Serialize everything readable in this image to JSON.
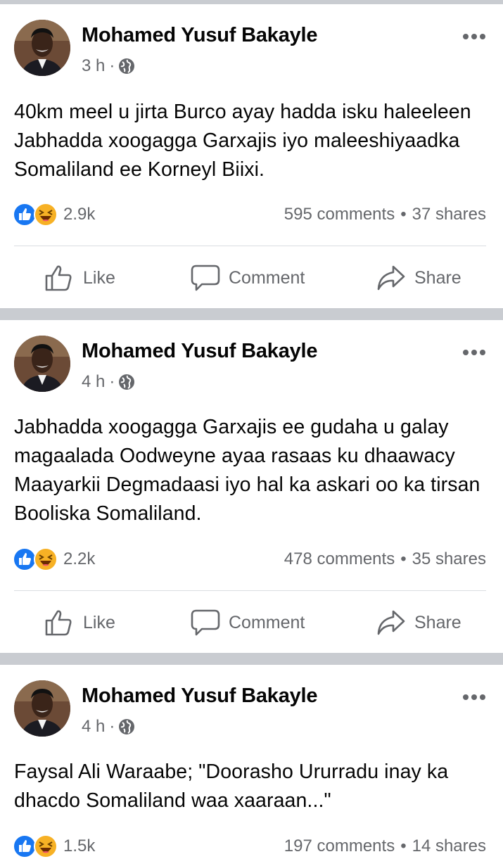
{
  "posts": [
    {
      "author": "Mohamed Yusuf Bakayle",
      "time": "3 h",
      "separator": "·",
      "text": "40km meel u jirta Burco ayay hadda isku haleeleen Jabhadda xoogagga Garxajis iyo maleeshiyaadka Somaliland ee Korneyl Biixi.",
      "reactions_count": "2.9k",
      "comments": "595 comments",
      "shares": "37 shares",
      "stat_separator": "•"
    },
    {
      "author": "Mohamed Yusuf Bakayle",
      "time": "4 h",
      "separator": "·",
      "text": "Jabhadda xoogagga Garxajis ee gudaha u galay magaalada Oodweyne ayaa rasaas ku dhaawacy Maayarkii Degmadaasi iyo hal ka askari oo ka tirsan Booliska Somaliland.",
      "reactions_count": "2.2k",
      "comments": "478 comments",
      "shares": "35 shares",
      "stat_separator": "•"
    },
    {
      "author": "Mohamed Yusuf Bakayle",
      "time": "4 h",
      "separator": "·",
      "text": "Faysal Ali Waraabe; \"Doorasho Ururradu inay ka dhacdo Somaliland waa xaaraan...\"",
      "reactions_count": "1.5k",
      "comments": "197 comments",
      "shares": "14 shares",
      "stat_separator": "•"
    }
  ],
  "actions": {
    "like": "Like",
    "comment": "Comment",
    "share": "Share"
  },
  "icons": {
    "like": "like-thumb-icon",
    "reaction_like": "like-reaction-icon",
    "reaction_haha": "haha-reaction-icon",
    "globe": "globe-icon",
    "more": "more-dots-icon",
    "comment": "comment-bubble-icon",
    "share": "share-arrow-icon"
  },
  "colors": {
    "like_blue": "#1877f2",
    "haha_yellow": "#f7b125",
    "secondary_text": "#65676b",
    "primary_text": "#050505",
    "separator_gray": "#c9ccd1"
  }
}
